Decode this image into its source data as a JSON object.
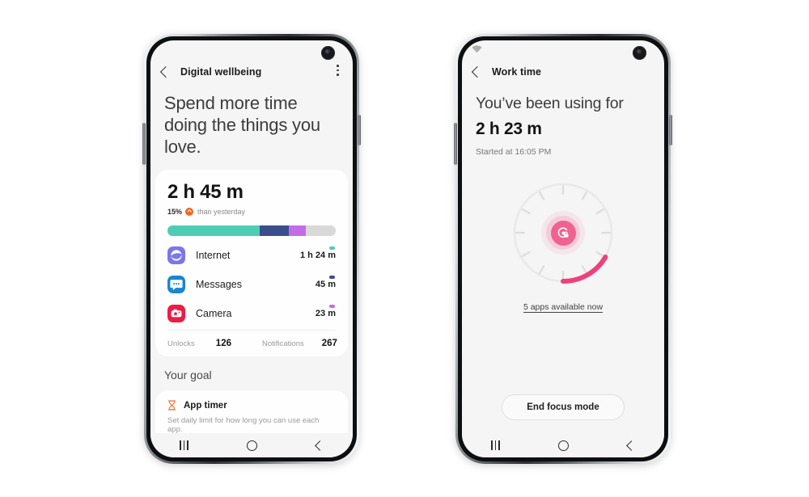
{
  "phone1": {
    "statusbar": {
      "camera": "punch-hole-camera"
    },
    "appbar": {
      "title": "Digital wellbeing",
      "back": "back-arrow",
      "menu": "overflow-menu"
    },
    "headline": "Spend more time doing the things you love.",
    "summary": {
      "total_time": "2 h 45 m",
      "delta_percent": "15%",
      "delta_text": "than yesterday",
      "delta_direction": "increase",
      "delta_badge_color": "#f26522"
    },
    "usage_bar": [
      {
        "name": "Internet",
        "percent": 55,
        "color": "#4ecdb4"
      },
      {
        "name": "Messages",
        "percent": 17,
        "color": "#3b4e8c"
      },
      {
        "name": "Camera",
        "percent": 10,
        "color": "#c46ce8"
      },
      {
        "name": "Remaining",
        "percent": 18,
        "color": "#d9d9d9"
      }
    ],
    "apps": [
      {
        "name": "Internet",
        "time": "1 h 24 m",
        "dot_color": "#4ecdb4",
        "icon": "internet-icon",
        "icon_bg": "#7b77e8"
      },
      {
        "name": "Messages",
        "time": "45 m",
        "dot_color": "#3b4e8c",
        "icon": "messages-icon",
        "icon_bg": "#1a86d0"
      },
      {
        "name": "Camera",
        "time": "23 m",
        "dot_color": "#c46ce8",
        "icon": "camera-icon",
        "icon_bg": "#ed1c45"
      }
    ],
    "counts": [
      {
        "label": "Unlocks",
        "value": "126"
      },
      {
        "label": "Notifications",
        "value": "267"
      }
    ],
    "goal_section_title": "Your goal",
    "goal_card": {
      "icon": "hourglass-icon",
      "icon_color": "#f26522",
      "title": "App timer",
      "subtitle": "Set daily limit for how long you can use each app."
    },
    "navbar": {
      "recents": "recents-button",
      "home": "home-button",
      "back": "back-button"
    }
  },
  "phone2": {
    "statusbar": {
      "wifi": "wifi-icon",
      "camera": "punch-hole-camera"
    },
    "appbar": {
      "title": "Work time",
      "back": "back-arrow"
    },
    "heading": "You’ve been using for",
    "duration": "2 h 23 m",
    "started": "Started at 16:05 PM",
    "dial": {
      "track_color": "#e7e7e7",
      "progress_color": "#f0407a",
      "progress_percent": 22,
      "tick_count": 12,
      "center_icon": "focus-mode-icon",
      "center_color": "#f0628f"
    },
    "apps_link": "5 apps available now",
    "end_button": "End focus mode",
    "navbar": {
      "recents": "recents-button",
      "home": "home-button",
      "back": "back-button"
    }
  }
}
